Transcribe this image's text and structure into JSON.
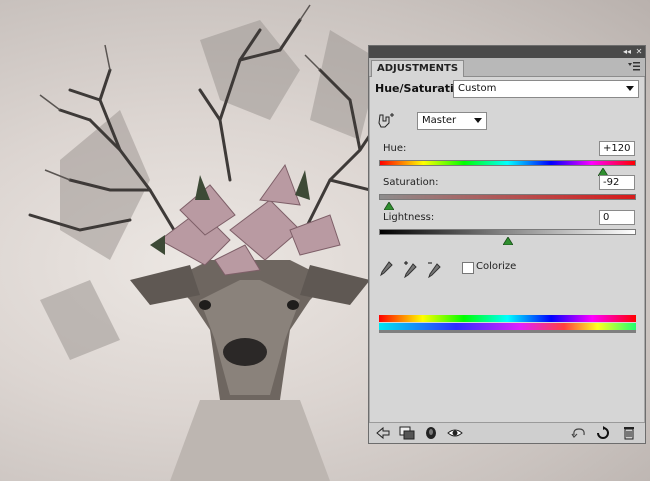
{
  "panel": {
    "tab_label": "ADJUSTMENTS",
    "collapse_glyph": "◂◂",
    "close_glyph": "✕",
    "menu_icon": "panel-menu-icon",
    "title": "Hue/Saturation",
    "preset": {
      "selected": "Custom"
    },
    "channel": {
      "selected": "Master"
    },
    "hue": {
      "label": "Hue:",
      "value": "+120",
      "fraction": 0.87
    },
    "saturation": {
      "label": "Saturation:",
      "value": "-92",
      "fraction": 0.04
    },
    "lightness": {
      "label": "Lightness:",
      "value": "0",
      "fraction": 0.5
    },
    "colorize": {
      "label": "Colorize",
      "checked": false
    },
    "eyedroppers": [
      "eyedropper-icon",
      "eyedropper-plus-icon",
      "eyedropper-minus-icon"
    ],
    "bottom_icons": {
      "left": [
        "back-arrow-icon",
        "clip-to-layer-icon",
        "layer-visibility-mask-icon",
        "eye-icon"
      ],
      "right": [
        "view-previous-icon",
        "reset-icon",
        "trash-icon"
      ]
    },
    "colors": {
      "panel_bg": "#d6d6d6",
      "topbar": "#4a4a4a",
      "thumb_green": "#2f8f2f"
    }
  }
}
